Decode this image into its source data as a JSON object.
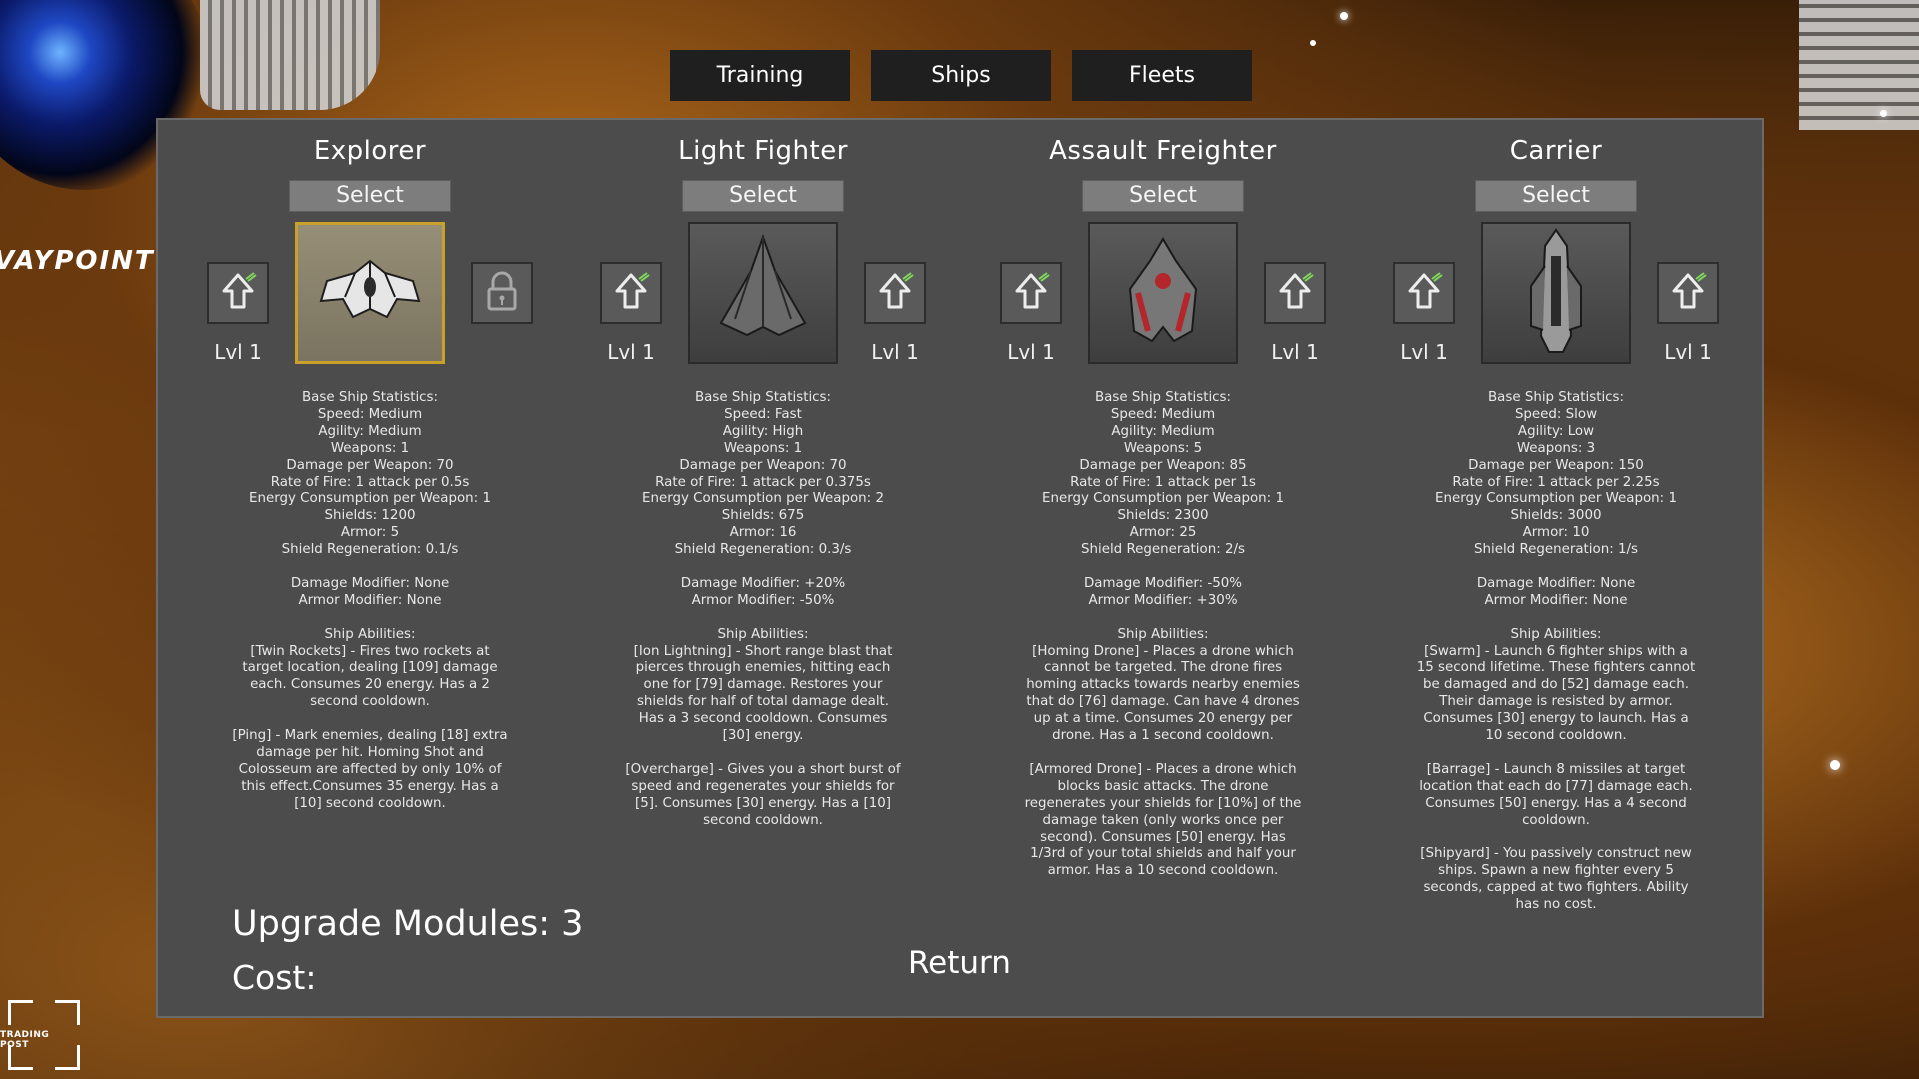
{
  "background": {
    "waypoint_label": "VAYPOINT",
    "trading_post_label": "TRADING POST"
  },
  "tabs": [
    "Training",
    "Ships",
    "Fleets"
  ],
  "ships": [
    {
      "name": "Explorer",
      "select_label": "Select",
      "selected": true,
      "left_level": "Lvl 1",
      "right_level": "",
      "right_locked": true,
      "icon": "explorer-ship-icon",
      "stats": [
        "Base Ship Statistics:",
        "Speed: Medium",
        "Agility: Medium",
        "Weapons: 1",
        "Damage per Weapon: 70",
        "Rate of Fire: 1 attack per 0.5s",
        "Energy Consumption per Weapon: 1",
        "Shields: 1200",
        "Armor: 5",
        "Shield Regeneration: 0.1/s",
        "",
        "Damage Modifier: None",
        "Armor Modifier: None",
        "",
        "Ship Abilities:",
        "[Twin Rockets] - Fires two rockets at",
        "target location, dealing [109] damage",
        "each. Consumes 20 energy. Has a 2",
        "second cooldown.",
        "",
        "[Ping] - Mark enemies, dealing [18] extra",
        "damage per hit. Homing Shot and",
        "Colosseum are affected by only 10% of",
        "this effect.Consumes 35 energy. Has a",
        "[10] second cooldown."
      ]
    },
    {
      "name": "Light Fighter",
      "select_label": "Select",
      "selected": false,
      "left_level": "Lvl 1",
      "right_level": "Lvl 1",
      "right_locked": false,
      "icon": "light-fighter-ship-icon",
      "stats": [
        "Base Ship Statistics:",
        "Speed: Fast",
        "Agility: High",
        "Weapons: 1",
        "Damage per Weapon: 70",
        "Rate of Fire: 1 attack per 0.375s",
        "Energy Consumption per Weapon: 2",
        "Shields: 675",
        "Armor: 16",
        "Shield Regeneration: 0.3/s",
        "",
        "Damage Modifier: +20%",
        "Armor Modifier: -50%",
        "",
        "Ship Abilities:",
        "[Ion Lightning] - Short range blast that",
        "pierces through enemies, hitting each",
        "one for [79] damage. Restores your",
        "shields for half of total damage dealt.",
        "Has a 3 second cooldown. Consumes",
        "[30] energy.",
        "",
        "[Overcharge] - Gives you a short burst of",
        "speed and regenerates your shields for",
        "[5]. Consumes [30] energy. Has a [10]",
        "second cooldown."
      ]
    },
    {
      "name": "Assault Freighter",
      "select_label": "Select",
      "selected": false,
      "left_level": "Lvl 1",
      "right_level": "Lvl 1",
      "right_locked": false,
      "icon": "assault-freighter-ship-icon",
      "stats": [
        "Base Ship Statistics:",
        "Speed: Medium",
        "Agility: Medium",
        "Weapons: 5",
        "Damage per Weapon: 85",
        "Rate of Fire: 1 attack per 1s",
        "Energy Consumption per Weapon: 1",
        "Shields: 2300",
        "Armor: 25",
        "Shield Regeneration: 2/s",
        "",
        "Damage Modifier: -50%",
        "Armor Modifier: +30%",
        "",
        "Ship Abilities:",
        "[Homing Drone] - Places a drone which",
        "cannot be targeted. The drone fires",
        "homing attacks towards nearby enemies",
        "that do [76] damage. Can have 4 drones",
        "up at a time. Consumes 20 energy per",
        "drone. Has a 1 second cooldown.",
        "",
        "[Armored Drone] - Places a drone which",
        "blocks basic attacks. The drone",
        "regenerates your shields for [10%] of the",
        "damage taken (only works once per",
        "second). Consumes [50] energy. Has",
        "1/3rd of your total shields and half your",
        "armor. Has a 10 second cooldown."
      ]
    },
    {
      "name": "Carrier",
      "select_label": "Select",
      "selected": false,
      "left_level": "Lvl 1",
      "right_level": "Lvl 1",
      "right_locked": false,
      "icon": "carrier-ship-icon",
      "stats": [
        "Base Ship Statistics:",
        "Speed: Slow",
        "Agility: Low",
        "Weapons: 3",
        "Damage per Weapon: 150",
        "Rate of Fire: 1 attack per 2.25s",
        "Energy Consumption per Weapon: 1",
        "Shields: 3000",
        "Armor: 10",
        "Shield Regeneration: 1/s",
        "",
        "Damage Modifier: None",
        "Armor Modifier: None",
        "",
        "Ship Abilities:",
        "[Swarm] - Launch 6 fighter ships with a",
        "15 second lifetime. These fighters cannot",
        "be damaged and do [52] damage each.",
        "Their damage is resisted by armor.",
        "Consumes [30] energy to launch. Has a",
        "10 second cooldown.",
        "",
        "[Barrage] - Launch 8 missiles at target",
        "location that each do [77] damage each.",
        "Consumes [50] energy. Has a 4 second",
        "cooldown.",
        "",
        "[Shipyard] - You passively construct new",
        "ships. Spawn a new fighter every 5",
        "seconds, capped at two fighters. Ability",
        "has no cost."
      ]
    }
  ],
  "footer": {
    "upgrade_modules": "Upgrade Modules: 3",
    "cost": "Cost:",
    "return_label": "Return"
  },
  "colors": {
    "panel": "#4c4c4c",
    "tab": "#1f1f1f",
    "selected_border": "#c9a029"
  }
}
